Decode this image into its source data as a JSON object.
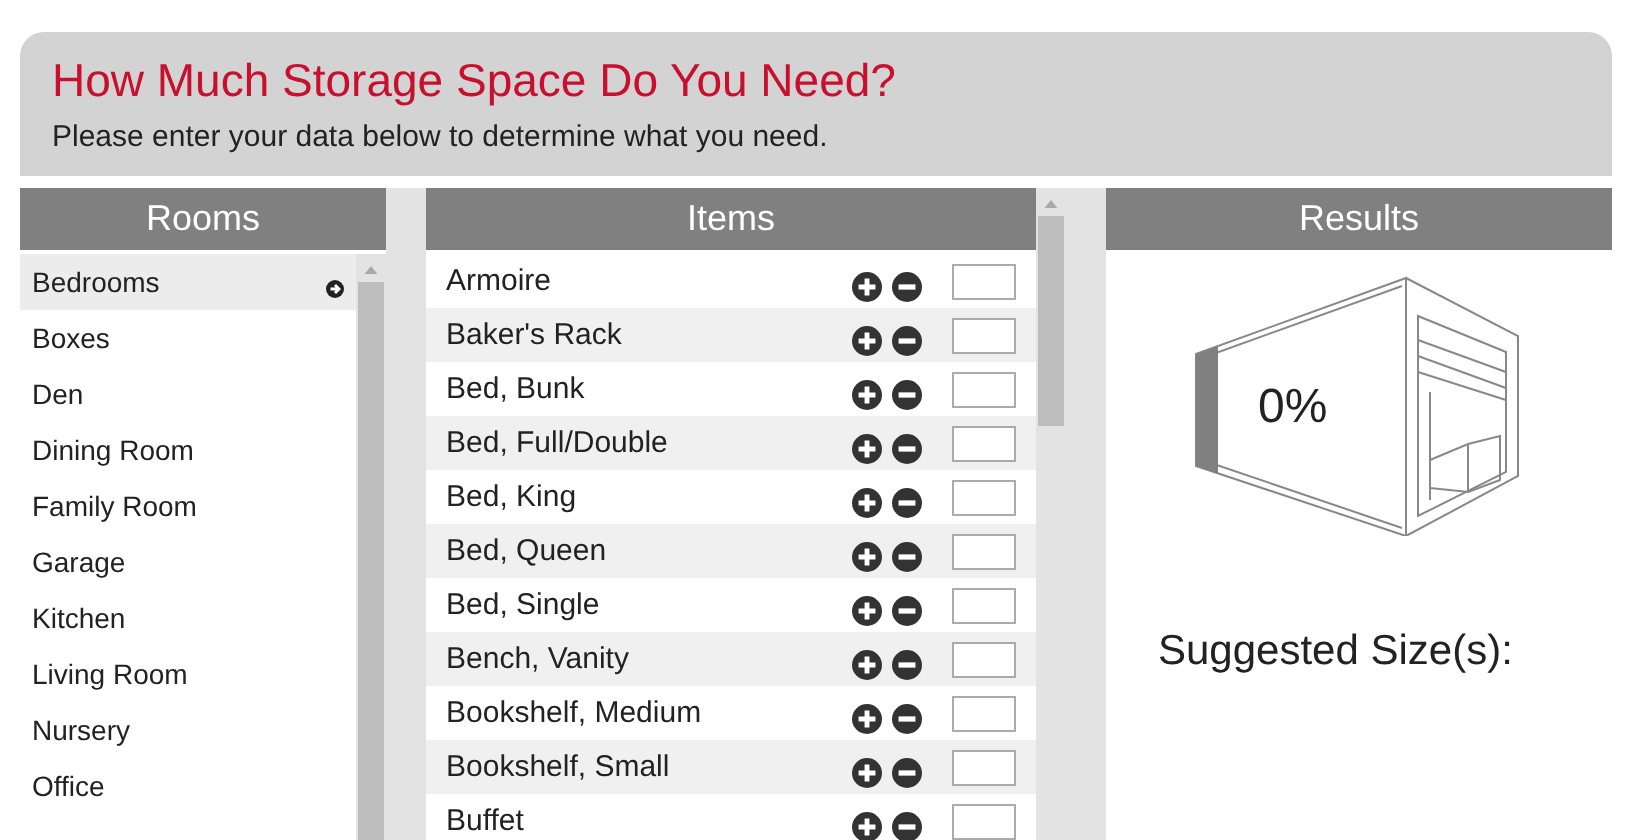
{
  "header": {
    "title": "How Much Storage Space Do You Need?",
    "subtitle": "Please enter your data below to determine what you need."
  },
  "rooms": {
    "heading": "Rooms",
    "items": [
      {
        "label": "Bedrooms",
        "selected": true
      },
      {
        "label": "Boxes",
        "selected": false
      },
      {
        "label": "Den",
        "selected": false
      },
      {
        "label": "Dining Room",
        "selected": false
      },
      {
        "label": "Family Room",
        "selected": false
      },
      {
        "label": "Garage",
        "selected": false
      },
      {
        "label": "Kitchen",
        "selected": false
      },
      {
        "label": "Living Room",
        "selected": false
      },
      {
        "label": "Nursery",
        "selected": false
      },
      {
        "label": "Office",
        "selected": false
      }
    ]
  },
  "items": {
    "heading": "Items",
    "rows": [
      {
        "name": "Armoire"
      },
      {
        "name": "Baker's Rack"
      },
      {
        "name": "Bed, Bunk"
      },
      {
        "name": "Bed, Full/Double"
      },
      {
        "name": "Bed, King"
      },
      {
        "name": "Bed, Queen"
      },
      {
        "name": "Bed, Single"
      },
      {
        "name": "Bench, Vanity"
      },
      {
        "name": "Bookshelf, Medium"
      },
      {
        "name": "Bookshelf, Small"
      },
      {
        "name": "Buffet"
      }
    ]
  },
  "results": {
    "heading": "Results",
    "percent": "0%",
    "suggested_label": "Suggested Size(s):"
  }
}
